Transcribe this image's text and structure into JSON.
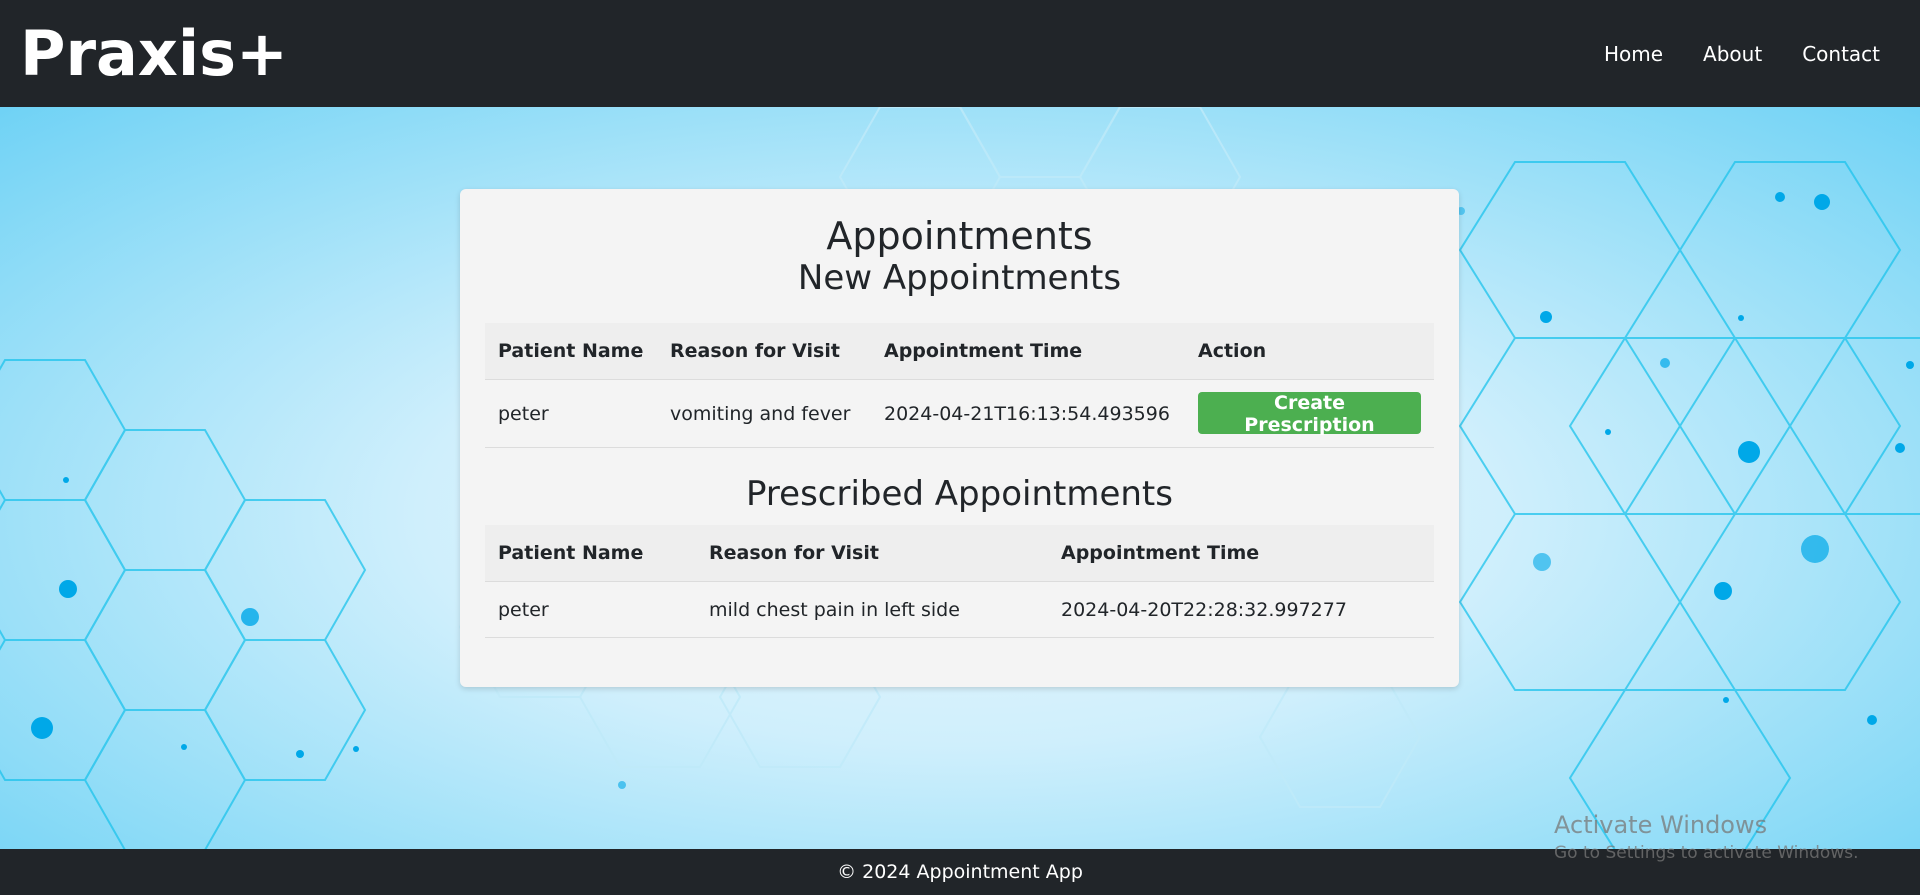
{
  "brand": "Praxis+",
  "nav": {
    "home": "Home",
    "about": "About",
    "contact": "Contact"
  },
  "page_title": "Appointments",
  "new_section": {
    "title": "New Appointments",
    "headers": [
      "Patient Name",
      "Reason for Visit",
      "Appointment Time",
      "Action"
    ],
    "rows": [
      {
        "patient": "peter",
        "reason": "vomiting and fever",
        "time": "2024-04-21T16:13:54.493596",
        "action": "Create Prescription"
      }
    ]
  },
  "prescribed_section": {
    "title": "Prescribed Appointments",
    "headers": [
      "Patient Name",
      "Reason for Visit",
      "Appointment Time"
    ],
    "rows": [
      {
        "patient": "peter",
        "reason": "mild chest pain in left side",
        "time": "2024-04-20T22:28:32.997277"
      }
    ]
  },
  "footer": "© 2024 Appointment App",
  "watermark": {
    "line1": "Activate Windows",
    "line2": "Go to Settings to activate Windows."
  },
  "colors": {
    "navbar": "#212529",
    "button": "#4caf50",
    "accent": "#00b4e6"
  }
}
